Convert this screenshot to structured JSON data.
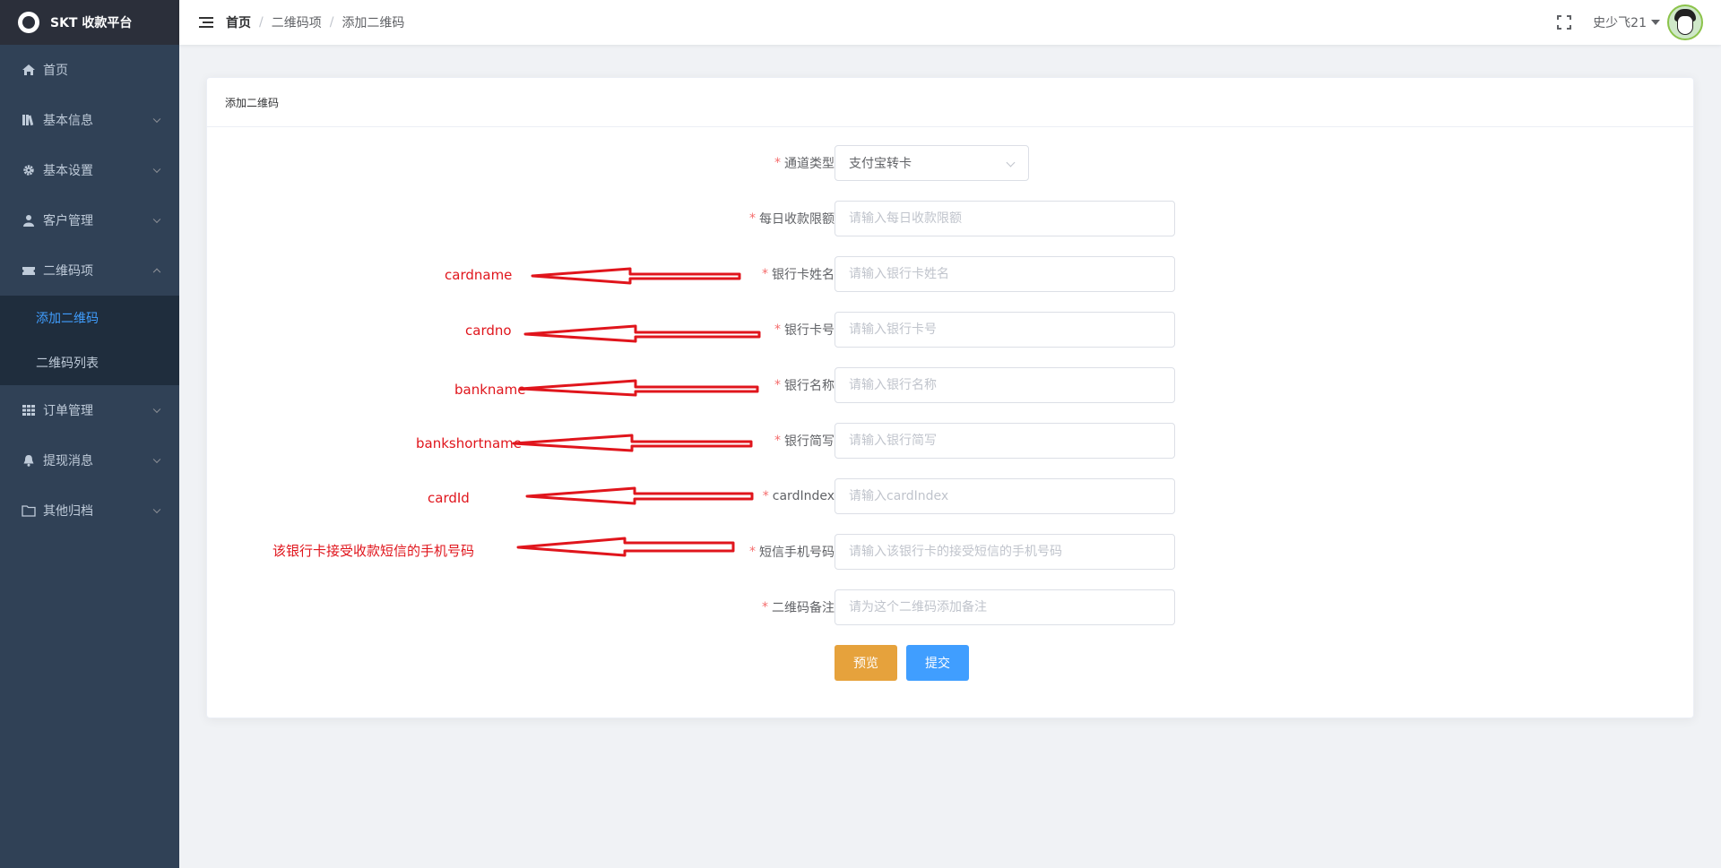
{
  "sidebar": {
    "app_title": "SKT 收款平台",
    "items": [
      {
        "label": "首页"
      },
      {
        "label": "基本信息"
      },
      {
        "label": "基本设置"
      },
      {
        "label": "客户管理"
      },
      {
        "label": "二维码项"
      },
      {
        "label": "订单管理"
      },
      {
        "label": "提现消息"
      },
      {
        "label": "其他归档"
      }
    ],
    "sub_items": [
      {
        "label": "添加二维码",
        "active": true
      },
      {
        "label": "二维码列表",
        "active": false
      }
    ],
    "active_color": "#409eff"
  },
  "header": {
    "breadcrumb": [
      "首页",
      "二维码项",
      "添加二维码"
    ],
    "username": "史少飞21"
  },
  "card": {
    "title": "添加二维码"
  },
  "form": {
    "channel_type": {
      "label": "通道类型",
      "value": "支付宝转卡"
    },
    "daily_limit": {
      "label": "每日收款限额",
      "placeholder": "请输入每日收款限额"
    },
    "card_name": {
      "label": "银行卡姓名",
      "placeholder": "请输入银行卡姓名"
    },
    "card_no": {
      "label": "银行卡号",
      "placeholder": "请输入银行卡号"
    },
    "bank_name": {
      "label": "银行名称",
      "placeholder": "请输入银行名称"
    },
    "bank_short": {
      "label": "银行简写",
      "placeholder": "请输入银行简写"
    },
    "card_index": {
      "label": "cardIndex",
      "placeholder": "请输入cardIndex"
    },
    "sms_phone": {
      "label": "短信手机号码",
      "placeholder": "请输入该银行卡的接受短信的手机号码"
    },
    "qr_note": {
      "label": "二维码备注",
      "placeholder": "请为这个二维码添加备注"
    },
    "preview_label": "预览",
    "submit_label": "提交"
  },
  "annotations": [
    "cardname",
    "cardno",
    "bankname",
    "bankshortname",
    "cardId",
    "该银行卡接受收款短信的手机号码"
  ],
  "colors": {
    "sidebar_bg": "#304156",
    "required": "#f56c6c",
    "preview_button": "#e6a23c",
    "submit_button": "#409eff",
    "annotation": "#e0151c"
  }
}
